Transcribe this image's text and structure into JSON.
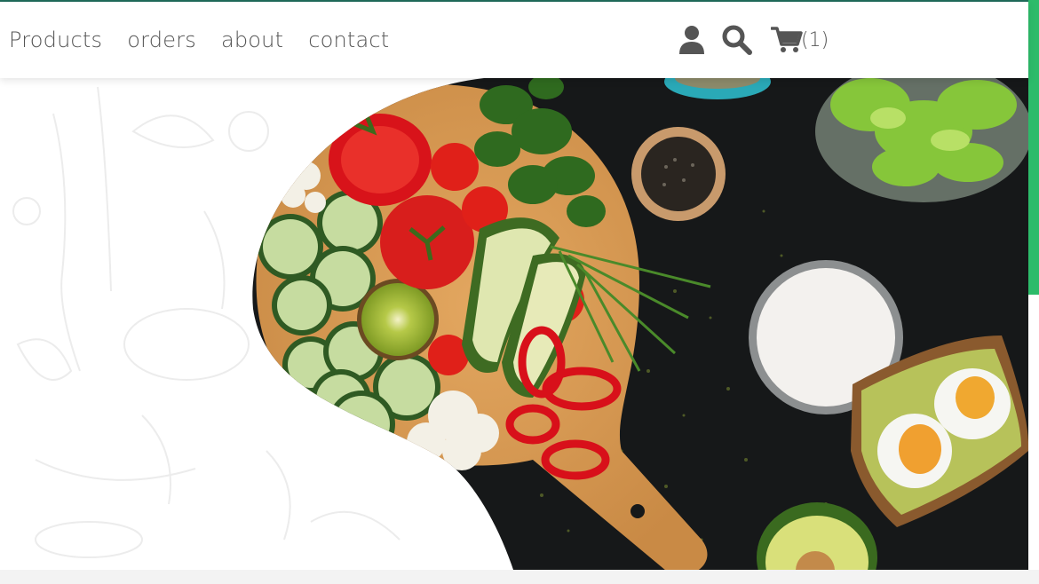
{
  "nav": {
    "links": [
      {
        "label": "Products"
      },
      {
        "label": "orders"
      },
      {
        "label": "about"
      },
      {
        "label": "contact"
      }
    ],
    "icons": {
      "user": "user-icon",
      "search": "search-icon",
      "cart": "cart-icon"
    },
    "cart_count": "(1)"
  },
  "colors": {
    "accent_green": "#2dbb6a",
    "nav_text": "#555555",
    "hero_dark": "#161819"
  }
}
